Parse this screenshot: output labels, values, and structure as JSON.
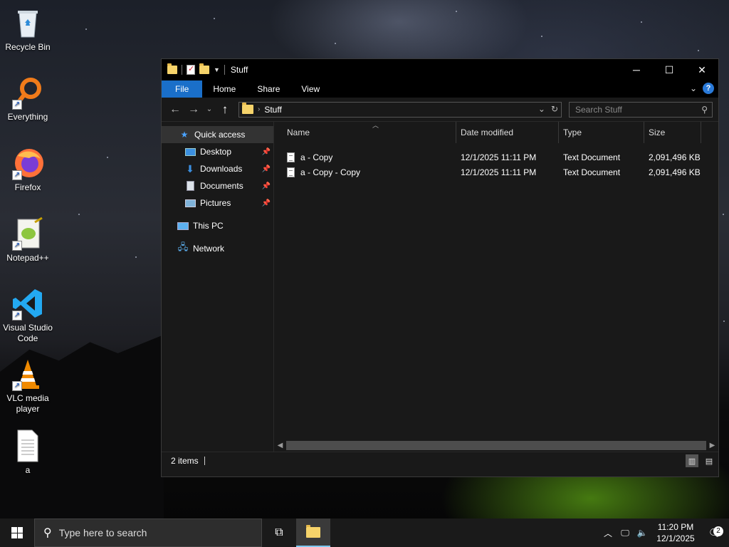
{
  "desktop": {
    "icons": [
      {
        "label": "Recycle Bin",
        "icon": "recycle-bin-icon"
      },
      {
        "label": "Everything",
        "icon": "everything-search-icon"
      },
      {
        "label": "Firefox",
        "icon": "firefox-icon"
      },
      {
        "label": "Notepad++",
        "icon": "notepadpp-icon"
      },
      {
        "label": "Visual Studio Code",
        "icon": "vscode-icon"
      },
      {
        "label": "VLC media player",
        "icon": "vlc-icon"
      },
      {
        "label": "a",
        "icon": "text-file-icon"
      }
    ]
  },
  "window": {
    "title": "Stuff",
    "ribbon_tabs": [
      "File",
      "Home",
      "Share",
      "View"
    ],
    "help_label": "?",
    "address": {
      "crumb": "Stuff"
    },
    "search": {
      "placeholder": "Search Stuff"
    },
    "nav": {
      "quick_access": "Quick access",
      "items": [
        "Desktop",
        "Downloads",
        "Documents",
        "Pictures"
      ],
      "this_pc": "This PC",
      "network": "Network"
    },
    "columns": [
      "Name",
      "Date modified",
      "Type",
      "Size"
    ],
    "files": [
      {
        "name": "a - Copy",
        "date": "12/1/2025 11:11 PM",
        "type": "Text Document",
        "size": "2,091,496 KB"
      },
      {
        "name": "a - Copy - Copy",
        "date": "12/1/2025 11:11 PM",
        "type": "Text Document",
        "size": "2,091,496 KB"
      }
    ],
    "status": "2 items"
  },
  "taskbar": {
    "search_placeholder": "Type here to search",
    "time": "11:20 PM",
    "date": "12/1/2025",
    "notification_count": "2"
  }
}
